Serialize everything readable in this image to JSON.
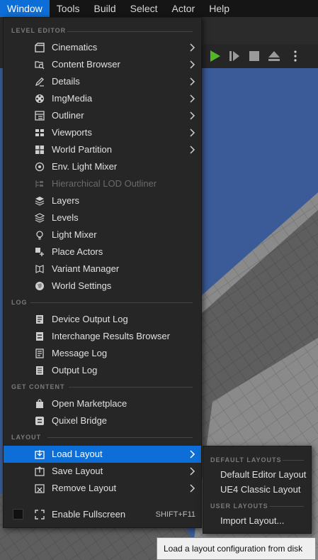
{
  "menubar": {
    "items": [
      "Window",
      "Tools",
      "Build",
      "Select",
      "Actor",
      "Help"
    ],
    "active_index": 0
  },
  "colors": {
    "accent": "#0e6ed7",
    "menu_bg": "#262626",
    "play_green": "#52b82a",
    "sky": "#3a5b98"
  },
  "menu": {
    "sections": {
      "level_editor": "LEVEL EDITOR",
      "log": "LOG",
      "get_content": "GET CONTENT",
      "layout": "LAYOUT"
    },
    "level_editor_items": [
      {
        "label": "Cinematics",
        "icon": "film-icon",
        "submenu": true
      },
      {
        "label": "Content Browser",
        "icon": "folder-search-icon",
        "submenu": true
      },
      {
        "label": "Details",
        "icon": "pencil-icon",
        "submenu": true
      },
      {
        "label": "ImgMedia",
        "icon": "film-reel-icon",
        "submenu": true
      },
      {
        "label": "Outliner",
        "icon": "outliner-list-icon",
        "submenu": true
      },
      {
        "label": "Viewports",
        "icon": "viewports-grid-icon",
        "submenu": true
      },
      {
        "label": "World Partition",
        "icon": "world-partition-grid-icon",
        "submenu": true
      },
      {
        "label": "Env. Light Mixer",
        "icon": "light-mixer-dial-icon",
        "submenu": false
      },
      {
        "label": "Hierarchical LOD Outliner",
        "icon": "lod-hierarchy-icon",
        "submenu": false,
        "disabled": true
      },
      {
        "label": "Layers",
        "icon": "layers-icon",
        "submenu": false
      },
      {
        "label": "Levels",
        "icon": "levels-stack-icon",
        "submenu": false
      },
      {
        "label": "Light Mixer",
        "icon": "light-bulb-icon",
        "submenu": false
      },
      {
        "label": "Place Actors",
        "icon": "place-actors-icon",
        "submenu": false
      },
      {
        "label": "Variant Manager",
        "icon": "variant-manager-icon",
        "submenu": false
      },
      {
        "label": "World Settings",
        "icon": "globe-icon",
        "submenu": false
      }
    ],
    "log_items": [
      {
        "label": "Device Output Log",
        "icon": "device-log-icon"
      },
      {
        "label": "Interchange Results Browser",
        "icon": "interchange-log-icon"
      },
      {
        "label": "Message Log",
        "icon": "message-log-icon"
      },
      {
        "label": "Output Log",
        "icon": "output-log-icon"
      }
    ],
    "get_content_items": [
      {
        "label": "Open Marketplace",
        "icon": "marketplace-bag-icon"
      },
      {
        "label": "Quixel Bridge",
        "icon": "quixel-bridge-icon"
      }
    ],
    "layout_items": [
      {
        "label": "Load Layout",
        "icon": "load-layout-icon",
        "submenu": true,
        "highlighted": true
      },
      {
        "label": "Save Layout",
        "icon": "save-layout-icon",
        "submenu": true
      },
      {
        "label": "Remove Layout",
        "icon": "remove-layout-icon",
        "submenu": true
      }
    ],
    "fullscreen": {
      "label": "Enable Fullscreen",
      "shortcut": "SHIFT+F11",
      "checked": false,
      "icon": "fullscreen-corners-icon"
    }
  },
  "submenu": {
    "default_section": "DEFAULT LAYOUTS",
    "default_items": [
      "Default Editor Layout",
      "UE4 Classic Layout"
    ],
    "user_section": "USER LAYOUTS",
    "user_items": [
      "Import Layout..."
    ]
  },
  "tooltip": "Load a layout configuration from disk",
  "toolbar": {
    "icons": [
      "play-icon",
      "step-forward-icon",
      "stop-icon",
      "eject-icon",
      "more-options-icon"
    ]
  }
}
